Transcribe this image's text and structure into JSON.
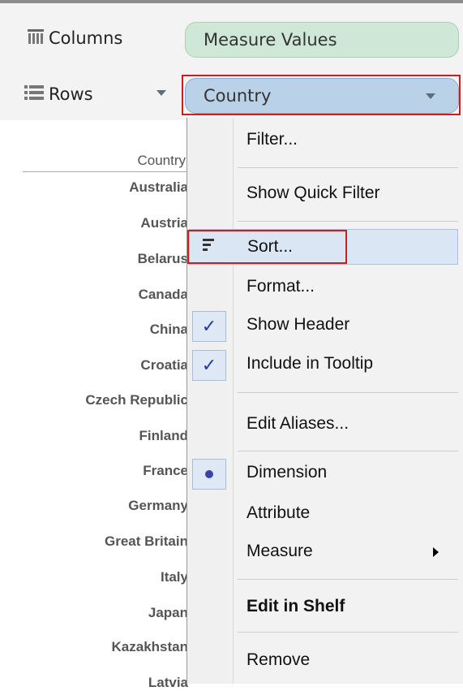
{
  "shelves": {
    "columns_label": "Columns",
    "columns_icon": "columns-grid-icon",
    "rows_label": "Rows",
    "rows_icon": "rows-list-icon",
    "columns_pill": "Measure Values",
    "rows_pill": "Country",
    "columns_pill_color": "#cfe7d7",
    "rows_pill_color": "#b9d2e8"
  },
  "view": {
    "header": "Country",
    "countries": [
      "Australia",
      "Austria",
      "Belarus",
      "Canada",
      "China",
      "Croatia",
      "Czech Republic",
      "Finland",
      "France",
      "Germany",
      "Great Britain",
      "Italy",
      "Japan",
      "Kazakhstan",
      "Latvia"
    ]
  },
  "context_menu": {
    "items": [
      {
        "label": "Filter..."
      },
      {
        "label": "Show Quick Filter"
      },
      {
        "label": "Sort...",
        "icon": "sort-icon",
        "highlighted": true
      },
      {
        "label": "Format..."
      },
      {
        "label": "Show Header",
        "checked": true
      },
      {
        "label": "Include in Tooltip",
        "checked": true
      },
      {
        "label": "Edit Aliases..."
      },
      {
        "label": "Dimension",
        "selected": true
      },
      {
        "label": "Attribute"
      },
      {
        "label": "Measure",
        "submenu": true
      },
      {
        "label": "Edit in Shelf",
        "bold": true
      },
      {
        "label": "Remove"
      }
    ]
  },
  "colors": {
    "highlight_outline": "#d01c1c",
    "check_color": "#2438a6"
  }
}
